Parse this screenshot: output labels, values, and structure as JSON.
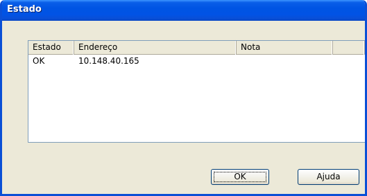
{
  "window": {
    "title": "Estado"
  },
  "list": {
    "columns": [
      "Estado",
      "Endereço",
      "Nota",
      ""
    ],
    "rows": [
      {
        "estado": "OK",
        "endereco": "10.148.40.165",
        "nota": ""
      }
    ]
  },
  "buttons": {
    "ok_label": "OK",
    "help_label": "Ajuda"
  }
}
